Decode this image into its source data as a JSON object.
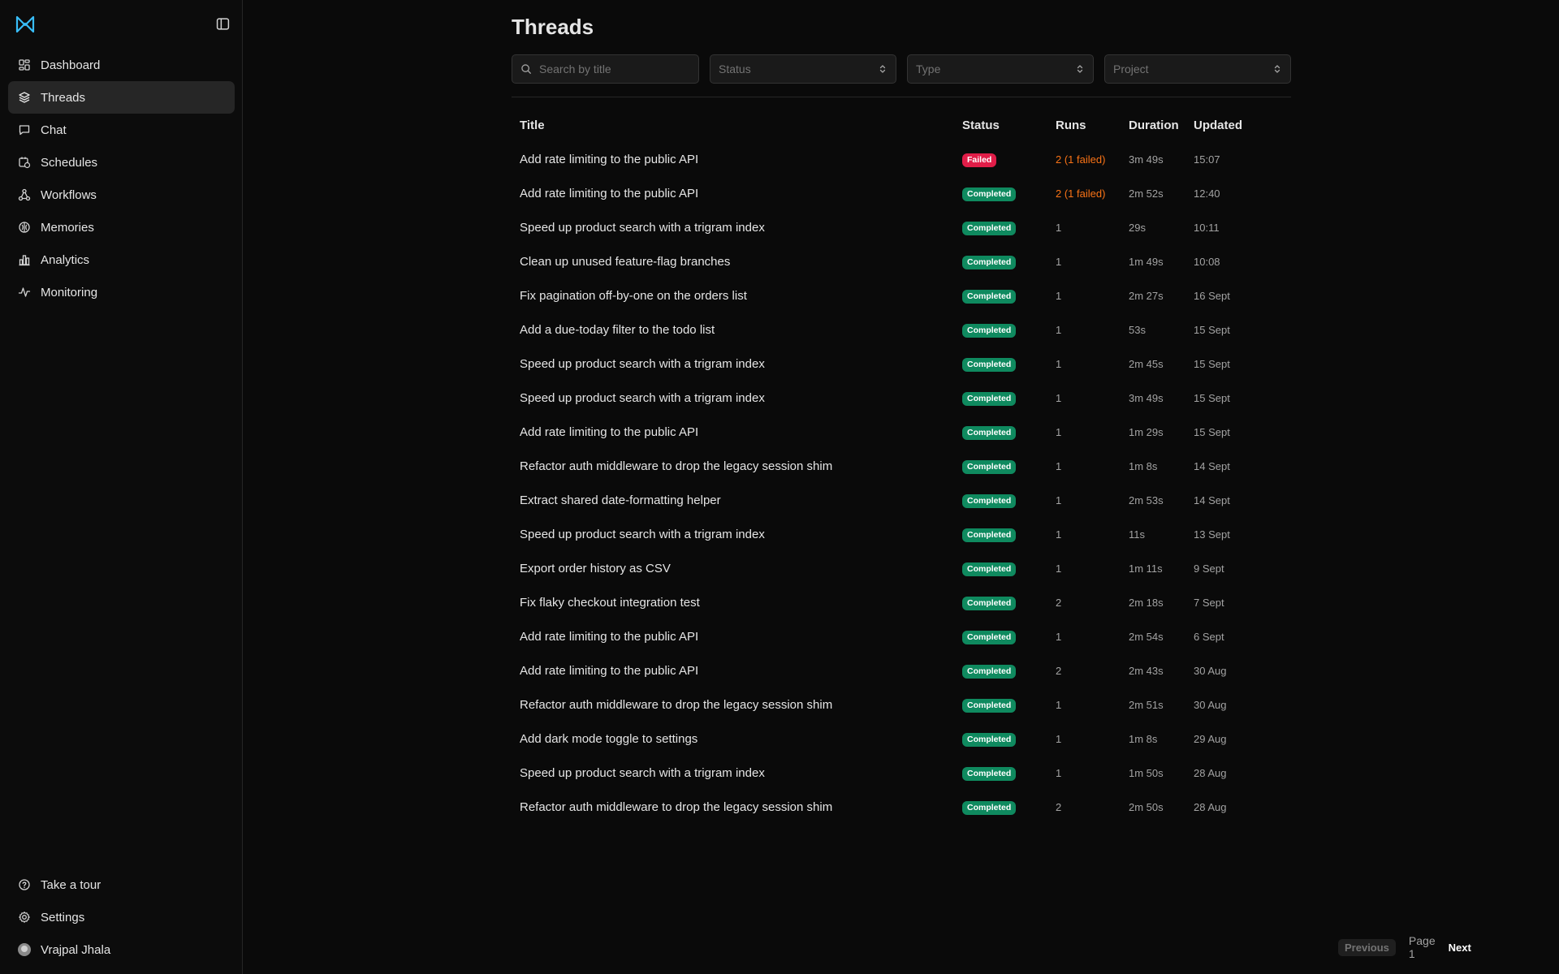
{
  "colors": {
    "background": "#0a0a0a",
    "sidebar_active": "#262626",
    "badge_completed": "#0f8a5f",
    "badge_failed": "#e11d48",
    "runs_failed_text": "#f97316",
    "logo": "#38bdf8"
  },
  "sidebar": {
    "items": [
      {
        "label": "Dashboard",
        "icon": "grid-icon"
      },
      {
        "label": "Threads",
        "icon": "layers-icon",
        "active": true
      },
      {
        "label": "Chat",
        "icon": "chat-bubble-icon"
      },
      {
        "label": "Schedules",
        "icon": "calendar-clock-icon"
      },
      {
        "label": "Workflows",
        "icon": "workflow-icon"
      },
      {
        "label": "Memories",
        "icon": "brain-icon"
      },
      {
        "label": "Analytics",
        "icon": "bar-chart-icon"
      },
      {
        "label": "Monitoring",
        "icon": "activity-icon"
      }
    ],
    "bottom": {
      "tour": "Take a tour",
      "settings": "Settings",
      "user": "Vrajpal Jhala"
    }
  },
  "page": {
    "title": "Threads"
  },
  "filters": {
    "search_placeholder": "Search by title",
    "status": "Status",
    "type": "Type",
    "project": "Project"
  },
  "table": {
    "headers": {
      "title": "Title",
      "status": "Status",
      "runs": "Runs",
      "duration": "Duration",
      "updated": "Updated"
    },
    "rows": [
      {
        "title": "Add rate limiting to the public API",
        "status": "Failed",
        "runs": "2 (1 failed)",
        "duration": "3m 49s",
        "updated": "15:07"
      },
      {
        "title": "Add rate limiting to the public API",
        "status": "Completed",
        "runs": "2 (1 failed)",
        "duration": "2m 52s",
        "updated": "12:40"
      },
      {
        "title": "Speed up product search with a trigram index",
        "status": "Completed",
        "runs": "1",
        "duration": "29s",
        "updated": "10:11"
      },
      {
        "title": "Clean up unused feature-flag branches",
        "status": "Completed",
        "runs": "1",
        "duration": "1m 49s",
        "updated": "10:08"
      },
      {
        "title": "Fix pagination off-by-one on the orders list",
        "status": "Completed",
        "runs": "1",
        "duration": "2m 27s",
        "updated": "16 Sept"
      },
      {
        "title": "Add a due-today filter to the todo list",
        "status": "Completed",
        "runs": "1",
        "duration": "53s",
        "updated": "15 Sept"
      },
      {
        "title": "Speed up product search with a trigram index",
        "status": "Completed",
        "runs": "1",
        "duration": "2m 45s",
        "updated": "15 Sept"
      },
      {
        "title": "Speed up product search with a trigram index",
        "status": "Completed",
        "runs": "1",
        "duration": "3m 49s",
        "updated": "15 Sept"
      },
      {
        "title": "Add rate limiting to the public API",
        "status": "Completed",
        "runs": "1",
        "duration": "1m 29s",
        "updated": "15 Sept"
      },
      {
        "title": "Refactor auth middleware to drop the legacy session shim",
        "status": "Completed",
        "runs": "1",
        "duration": "1m 8s",
        "updated": "14 Sept"
      },
      {
        "title": "Extract shared date-formatting helper",
        "status": "Completed",
        "runs": "1",
        "duration": "2m 53s",
        "updated": "14 Sept"
      },
      {
        "title": "Speed up product search with a trigram index",
        "status": "Completed",
        "runs": "1",
        "duration": "11s",
        "updated": "13 Sept"
      },
      {
        "title": "Export order history as CSV",
        "status": "Completed",
        "runs": "1",
        "duration": "1m 11s",
        "updated": "9 Sept"
      },
      {
        "title": "Fix flaky checkout integration test",
        "status": "Completed",
        "runs": "2",
        "duration": "2m 18s",
        "updated": "7 Sept"
      },
      {
        "title": "Add rate limiting to the public API",
        "status": "Completed",
        "runs": "1",
        "duration": "2m 54s",
        "updated": "6 Sept"
      },
      {
        "title": "Add rate limiting to the public API",
        "status": "Completed",
        "runs": "2",
        "duration": "2m 43s",
        "updated": "30 Aug"
      },
      {
        "title": "Refactor auth middleware to drop the legacy session shim",
        "status": "Completed",
        "runs": "1",
        "duration": "2m 51s",
        "updated": "30 Aug"
      },
      {
        "title": "Add dark mode toggle to settings",
        "status": "Completed",
        "runs": "1",
        "duration": "1m 8s",
        "updated": "29 Aug"
      },
      {
        "title": "Speed up product search with a trigram index",
        "status": "Completed",
        "runs": "1",
        "duration": "1m 50s",
        "updated": "28 Aug"
      },
      {
        "title": "Refactor auth middleware to drop the legacy session shim",
        "status": "Completed",
        "runs": "2",
        "duration": "2m 50s",
        "updated": "28 Aug"
      }
    ]
  },
  "pagination": {
    "previous": "Previous",
    "page": "Page 1",
    "next": "Next"
  }
}
